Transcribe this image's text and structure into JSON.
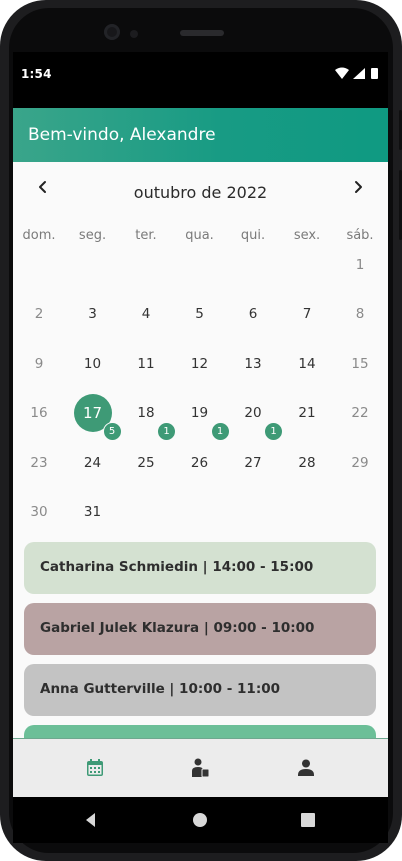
{
  "status_bar": {
    "time": "1:54",
    "icons": [
      "wifi-icon",
      "cellular-signal-icon",
      "battery-icon"
    ]
  },
  "app_bar": {
    "title": "Bem-vindo, Alexandre",
    "gradient_colors": [
      "#3aa58a",
      "#0f9a82"
    ]
  },
  "calendar": {
    "month_label": "outubro de 2022",
    "prev_icon": "chevron-left-icon",
    "next_icon": "chevron-right-icon",
    "weekdays": [
      "dom.",
      "seg.",
      "ter.",
      "qua.",
      "qui.",
      "sex.",
      "sáb."
    ],
    "selected_day": "17",
    "accent_color": "#3e9a76",
    "days": [
      {
        "label": "1"
      },
      {
        "label": "2"
      },
      {
        "label": "3"
      },
      {
        "label": "4"
      },
      {
        "label": "5"
      },
      {
        "label": "6"
      },
      {
        "label": "7"
      },
      {
        "label": "8"
      },
      {
        "label": "9"
      },
      {
        "label": "10"
      },
      {
        "label": "11"
      },
      {
        "label": "12"
      },
      {
        "label": "13"
      },
      {
        "label": "14"
      },
      {
        "label": "15"
      },
      {
        "label": "16"
      },
      {
        "label": "17",
        "count": "5"
      },
      {
        "label": "18",
        "count": "1"
      },
      {
        "label": "19",
        "count": "1"
      },
      {
        "label": "20",
        "count": "1"
      },
      {
        "label": "21"
      },
      {
        "label": "22"
      },
      {
        "label": "23"
      },
      {
        "label": "24"
      },
      {
        "label": "25"
      },
      {
        "label": "26"
      },
      {
        "label": "27"
      },
      {
        "label": "28"
      },
      {
        "label": "29"
      },
      {
        "label": "30"
      },
      {
        "label": "31"
      }
    ]
  },
  "appointments": [
    {
      "text": "Catharina Schmiedin | 14:00 - 15:00",
      "color": "#d4e1d1"
    },
    {
      "text": "Gabriel Julek Klazura | 09:00 - 10:00",
      "color": "#b9a3a3"
    },
    {
      "text": "Anna Gutterville | 10:00 - 11:00",
      "color": "#c3c3c3"
    },
    {
      "text": "",
      "color": "#6cbf98"
    }
  ],
  "bottom_nav": {
    "items": [
      {
        "icon": "calendar-icon",
        "active": true
      },
      {
        "icon": "person-with-clipboard-icon",
        "active": false
      },
      {
        "icon": "person-icon",
        "active": false
      }
    ],
    "active_color": "#3e9a76"
  },
  "system_nav": {
    "items": [
      "back-icon",
      "home-icon",
      "recents-icon"
    ]
  }
}
